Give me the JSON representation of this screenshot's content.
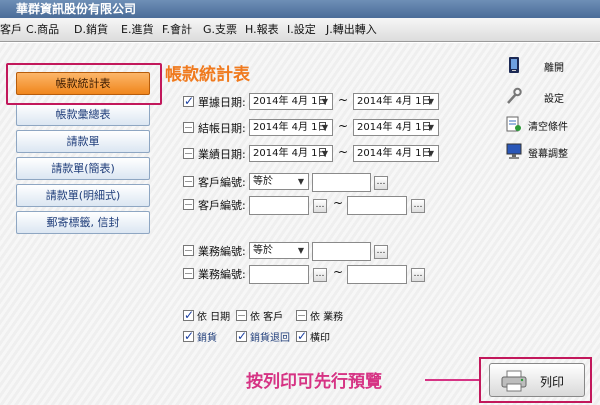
{
  "titlebar": {
    "title": "華群資訊股份有限公司"
  },
  "menu": [
    "客戶",
    "C.商品",
    "D.銷貨",
    "E.進貨",
    "F.會計",
    "G.支票",
    "H.報表",
    "I.設定",
    "J.轉出轉入"
  ],
  "sidebar": {
    "items": [
      {
        "label": "帳款統計表"
      },
      {
        "label": "帳款彙總表"
      },
      {
        "label": "請款單"
      },
      {
        "label": "請款單(簡表)"
      },
      {
        "label": "請款單(明細式)"
      },
      {
        "label": "郵寄標籤, 信封"
      }
    ]
  },
  "main": {
    "heading": "帳款統計表",
    "date_filters": [
      {
        "label": "單據日期:",
        "checked": true,
        "from": "2014年 4月 1日",
        "to": "2014年 4月 1日"
      },
      {
        "label": "結帳日期:",
        "checked": false,
        "from": "2014年 4月 1日",
        "to": "2014年 4月 1日"
      },
      {
        "label": "業績日期:",
        "checked": false,
        "from": "2014年 4月 1日",
        "to": "2014年 4月 1日"
      }
    ],
    "range_separator": "~",
    "customer": {
      "label1": "客戶編號:",
      "operator": "等於",
      "value": "",
      "label2": "客戶編號:",
      "from": "",
      "to": ""
    },
    "sales": {
      "label1": "業務編號:",
      "operator": "等於",
      "value": "",
      "label2": "業務編號:",
      "from": "",
      "to": ""
    },
    "sort_options": [
      {
        "label": "依 日期",
        "checked": true
      },
      {
        "label": "依 客戶",
        "checked": false
      },
      {
        "label": "依 業務",
        "checked": false
      }
    ],
    "include_options": [
      {
        "label": "銷貨",
        "checked": true
      },
      {
        "label": "銷貨退回",
        "checked": true
      },
      {
        "label": "橫印",
        "checked": true
      }
    ]
  },
  "tools": [
    {
      "label": "離開",
      "icon": "exit-door-icon"
    },
    {
      "label": "設定",
      "icon": "wrench-icon"
    },
    {
      "label": "清空條件",
      "icon": "clear-conditions-icon"
    },
    {
      "label": "螢幕調整",
      "icon": "monitor-icon"
    }
  ],
  "annotation": {
    "text": "按列印可先行預覽"
  },
  "print_button": {
    "label": "列印",
    "icon": "printer-icon"
  },
  "colors": {
    "accent": "#f07a1e",
    "highlight": "#c2185b",
    "annotation": "#d63384",
    "link": "#1f3d7a"
  }
}
